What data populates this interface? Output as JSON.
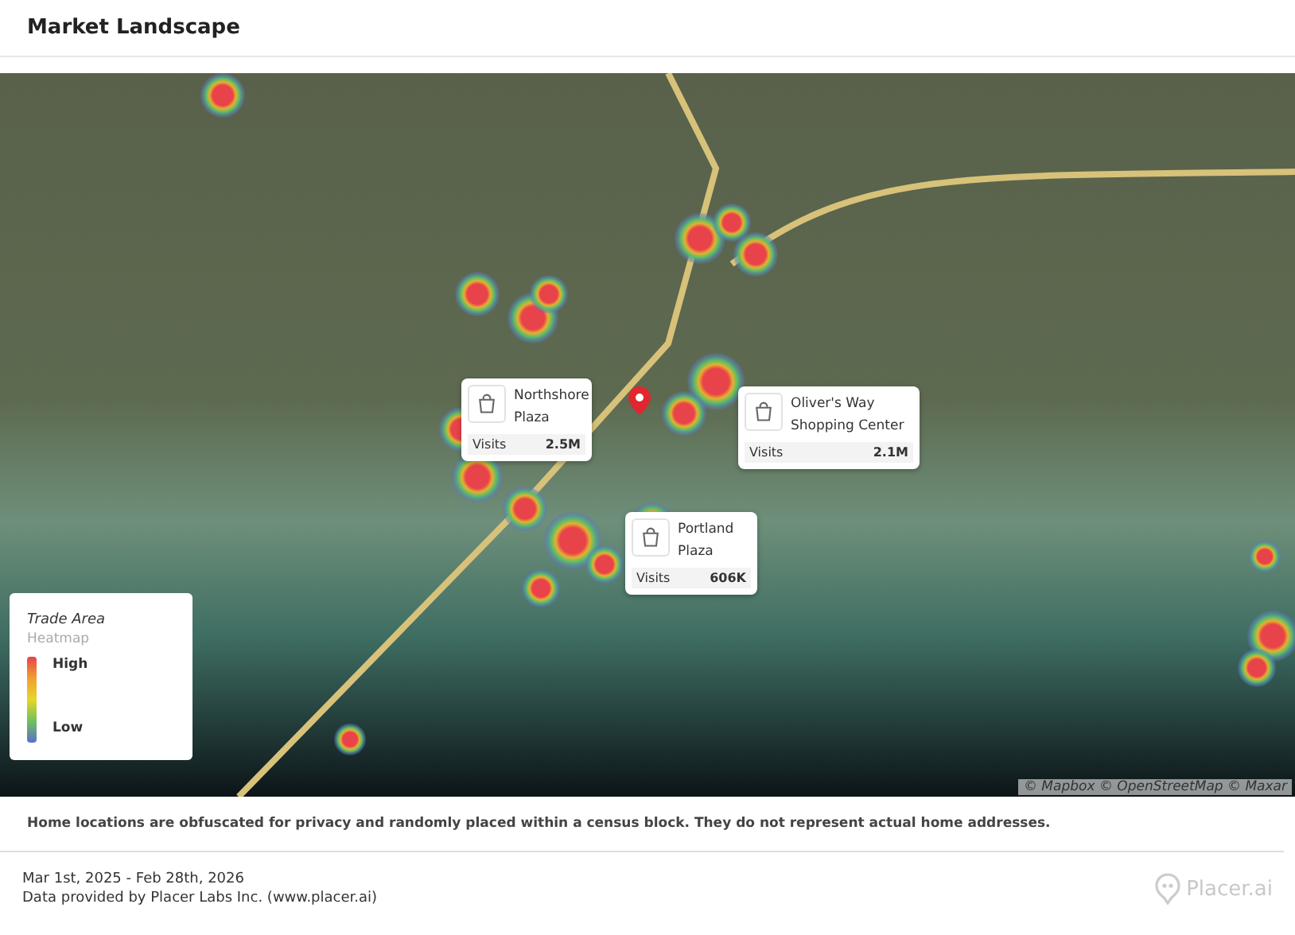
{
  "header": {
    "title": "Market Landscape"
  },
  "map": {
    "attribution": "© Mapbox © OpenStreetMap © Maxar",
    "places": [
      {
        "name": "Northshore Plaza",
        "visits_label": "Visits",
        "visits": "2.5M"
      },
      {
        "name": "Oliver's Way Shopping Center",
        "visits_label": "Visits",
        "visits": "2.1M"
      },
      {
        "name": "Portland Plaza",
        "visits_label": "Visits",
        "visits": "606K"
      }
    ],
    "legend": {
      "title": "Trade Area",
      "subtitle": "Heatmap",
      "high": "High",
      "low": "Low"
    }
  },
  "disclaimer": "Home locations are obfuscated for privacy and randomly placed within a census block. They do not represent actual home addresses.",
  "footer": {
    "date_range": "Mar 1st, 2025 - Feb 28th, 2026",
    "source": "Data provided by Placer Labs Inc. (www.placer.ai)",
    "brand": "Placer.ai"
  }
}
